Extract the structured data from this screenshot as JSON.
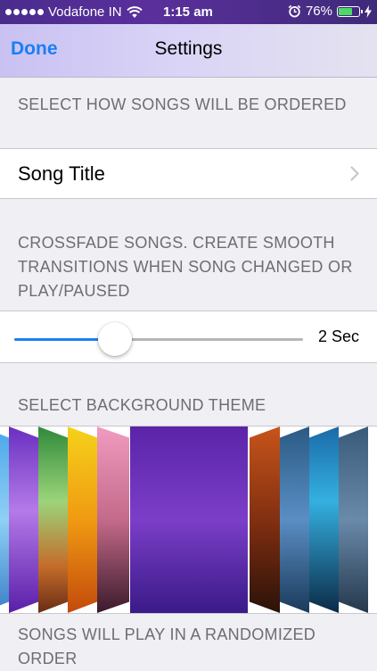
{
  "status_bar": {
    "carrier": "Vodafone IN",
    "time": "1:15 am",
    "battery_percent": "76%",
    "battery_level": 0.76
  },
  "nav": {
    "done_label": "Done",
    "title": "Settings"
  },
  "song_order": {
    "header": "SELECT HOW SONGS WILL BE ORDERED",
    "value": "Song Title"
  },
  "crossfade": {
    "header": "CROSSFADE SONGS. CREATE SMOOTH TRANSITIONS WHEN SONG CHANGED OR PLAY/PAUSED",
    "value_label": "2 Sec",
    "slider_fraction": 0.35
  },
  "theme": {
    "header": "SELECT BACKGROUND THEME",
    "cards": [
      {
        "name": "sky-blue",
        "gradient": "linear-gradient(180deg,#4aa6e8,#8fd0f5 50%,#3a7fc8)"
      },
      {
        "name": "violet",
        "gradient": "linear-gradient(180deg,#6a2fc0,#b47ae8 45%,#5a1fa8)"
      },
      {
        "name": "green",
        "gradient": "linear-gradient(180deg,#2f8a3a,#9bd47a 40%,#c46c2a 75%,#6a2c14)"
      },
      {
        "name": "yellow-orange",
        "gradient": "linear-gradient(180deg,#f5d21a,#f09a12 50%,#c24a0c)"
      },
      {
        "name": "pink",
        "gradient": "linear-gradient(180deg,#f09bc0,#c46a8a 50%,#3a1a2a)"
      },
      {
        "name": "purple-selected",
        "gradient": "linear-gradient(180deg,#5a24a8,#7b3ec8 50%,#3a1a88)"
      },
      {
        "name": "copper",
        "gradient": "linear-gradient(180deg,#c8541a,#7a2c10 55%,#2a1208)"
      },
      {
        "name": "steel-blue",
        "gradient": "linear-gradient(180deg,#2a5a84,#5a8ec4 50%,#1a3a5a)"
      },
      {
        "name": "teal",
        "gradient": "linear-gradient(180deg,#1a6aa8,#34b0e0 40%,#0c2a48)"
      },
      {
        "name": "slate",
        "gradient": "linear-gradient(180deg,#3a5a7a,#6a8aaa 50%,#24384c)"
      }
    ]
  },
  "shuffle": {
    "header": "SONGS WILL PLAY IN A RANDOMIZED ORDER"
  }
}
